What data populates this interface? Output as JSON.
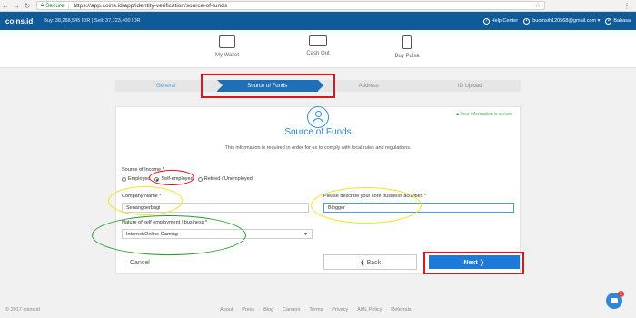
{
  "browser": {
    "secure_label": "Secure",
    "url": "https://app.coins.id/app/identity-verification/source-of-funds"
  },
  "header": {
    "logo": "coins.id",
    "rates": "Buy: 38,268,545 IDR | Sell: 37,723,400 IDR",
    "help": "Help Center",
    "email": "ibuomsih120568@gmail.com",
    "language": "Bahasa"
  },
  "nav": {
    "items": [
      {
        "label": "My Wallet",
        "icon": "wallet-icon"
      },
      {
        "label": "Cash Out",
        "icon": "cash-icon"
      },
      {
        "label": "Buy Pulsa",
        "icon": "phone-icon"
      }
    ]
  },
  "stepper": {
    "steps": [
      "General",
      "Source of Funds",
      "Address",
      "ID Upload"
    ]
  },
  "form": {
    "secure_note": "Your information is secure",
    "title": "Source of Funds",
    "description": "This information is required in order for us to comply with local rules and regulations.",
    "income_label": "Source of Income *",
    "income_options": [
      "Employed",
      "Self-employed",
      "Retired / Unemployed"
    ],
    "income_selected": "Self-employed",
    "company_label": "Company Name *",
    "company_value": "Senangberbagi",
    "nature_label": "Nature of self employment / business *",
    "nature_value": "Internet/Online Gaming",
    "describe_label": "Please describe your core business activities *",
    "describe_value": "Blogger",
    "cancel": "Cancel",
    "back": "❮ Back",
    "next": "Next ❯"
  },
  "footer": {
    "copyright": "© 2017 coins.id",
    "links": [
      "About",
      "Press",
      "Blog",
      "Careers",
      "Terms",
      "Privacy",
      "AML Policy",
      "Referrals"
    ]
  },
  "chat": {
    "badge": "2"
  },
  "colors": {
    "brand": "#0f5a98",
    "accent": "#1d7ad8",
    "annotation_red": "#e0151c",
    "annotation_yellow": "#f5e21b",
    "annotation_green": "#1fa02a"
  }
}
